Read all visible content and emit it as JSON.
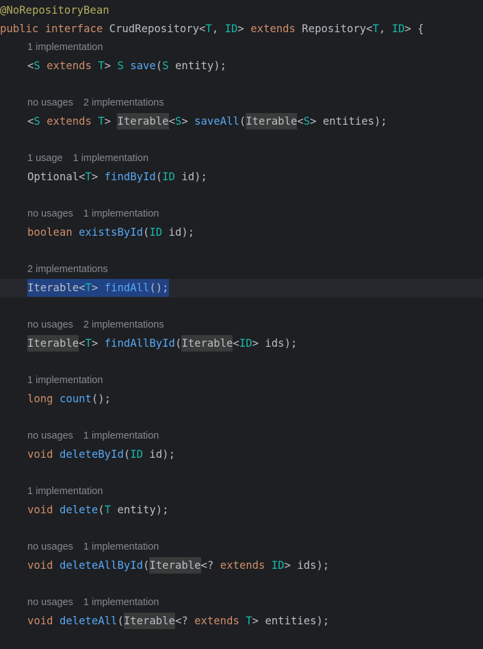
{
  "annotation": [
    [
      "@NoRepositoryBean",
      "a"
    ]
  ],
  "declaration": [
    [
      "public",
      "k"
    ],
    [
      " ",
      ""
    ],
    [
      "interface",
      "k"
    ],
    [
      " CrudRepository<",
      ""
    ],
    [
      "T",
      "t"
    ],
    [
      ", ",
      ""
    ],
    [
      "ID",
      "t"
    ],
    [
      "> ",
      ""
    ],
    [
      "extends",
      "k"
    ],
    [
      " Repository<",
      ""
    ],
    [
      "T",
      "t"
    ],
    [
      ", ",
      ""
    ],
    [
      "ID",
      "t"
    ],
    [
      "> {",
      ""
    ]
  ],
  "selected_index": 4,
  "colors": {
    "background": "#1e1f22",
    "selection": "#214283",
    "keyword": "#cf8e6d",
    "type_param": "#16baac",
    "method": "#56a8f5",
    "annotation": "#b3ae60"
  },
  "methods": [
    {
      "hints": [
        "1 implementation"
      ],
      "tokens": [
        [
          "<",
          ""
        ],
        [
          "S",
          "t"
        ],
        [
          " ",
          ""
        ],
        [
          "extends",
          "k"
        ],
        [
          " ",
          ""
        ],
        [
          "T",
          "t"
        ],
        [
          "> ",
          ""
        ],
        [
          "S",
          "t"
        ],
        [
          " ",
          ""
        ],
        [
          "save",
          "f"
        ],
        [
          "(",
          ""
        ],
        [
          "S",
          "t"
        ],
        [
          " entity);",
          ""
        ]
      ]
    },
    {
      "hints": [
        "no usages",
        "2 implementations"
      ],
      "tokens": [
        [
          "<",
          ""
        ],
        [
          "S",
          "t"
        ],
        [
          " ",
          ""
        ],
        [
          "extends",
          "k"
        ],
        [
          " ",
          ""
        ],
        [
          "T",
          "t"
        ],
        [
          "> ",
          ""
        ],
        [
          "Iterable",
          "h"
        ],
        [
          "<",
          ""
        ],
        [
          "S",
          "t"
        ],
        [
          "> ",
          ""
        ],
        [
          "saveAll",
          "f"
        ],
        [
          "(",
          ""
        ],
        [
          "Iterable",
          "h"
        ],
        [
          "<",
          ""
        ],
        [
          "S",
          "t"
        ],
        [
          "> entities);",
          ""
        ]
      ]
    },
    {
      "hints": [
        "1 usage",
        "1 implementation"
      ],
      "tokens": [
        [
          "Optional<",
          ""
        ],
        [
          "T",
          "t"
        ],
        [
          "> ",
          ""
        ],
        [
          "findById",
          "f"
        ],
        [
          "(",
          ""
        ],
        [
          "ID",
          "t"
        ],
        [
          " id);",
          ""
        ]
      ]
    },
    {
      "hints": [
        "no usages",
        "1 implementation"
      ],
      "tokens": [
        [
          "boolean",
          "k"
        ],
        [
          " ",
          ""
        ],
        [
          "existsById",
          "f"
        ],
        [
          "(",
          ""
        ],
        [
          "ID",
          "t"
        ],
        [
          " id);",
          ""
        ]
      ]
    },
    {
      "hints": [
        "2 implementations"
      ],
      "tokens": [
        [
          "Iterable<",
          ""
        ],
        [
          "T",
          "t"
        ],
        [
          "> ",
          ""
        ],
        [
          "findAll",
          "f"
        ],
        [
          "();",
          ""
        ]
      ]
    },
    {
      "hints": [
        "no usages",
        "2 implementations"
      ],
      "tokens": [
        [
          "Iterable",
          "h"
        ],
        [
          "<",
          ""
        ],
        [
          "T",
          "t"
        ],
        [
          "> ",
          ""
        ],
        [
          "findAllById",
          "f"
        ],
        [
          "(",
          ""
        ],
        [
          "Iterable",
          "h"
        ],
        [
          "<",
          ""
        ],
        [
          "ID",
          "t"
        ],
        [
          "> ids);",
          ""
        ]
      ]
    },
    {
      "hints": [
        "1 implementation"
      ],
      "tokens": [
        [
          "long",
          "k"
        ],
        [
          " ",
          ""
        ],
        [
          "count",
          "f"
        ],
        [
          "();",
          ""
        ]
      ]
    },
    {
      "hints": [
        "no usages",
        "1 implementation"
      ],
      "tokens": [
        [
          "void",
          "k"
        ],
        [
          " ",
          ""
        ],
        [
          "deleteById",
          "f"
        ],
        [
          "(",
          ""
        ],
        [
          "ID",
          "t"
        ],
        [
          " id);",
          ""
        ]
      ]
    },
    {
      "hints": [
        "1 implementation"
      ],
      "tokens": [
        [
          "void",
          "k"
        ],
        [
          " ",
          ""
        ],
        [
          "delete",
          "f"
        ],
        [
          "(",
          ""
        ],
        [
          "T",
          "t"
        ],
        [
          " entity);",
          ""
        ]
      ]
    },
    {
      "hints": [
        "no usages",
        "1 implementation"
      ],
      "tokens": [
        [
          "void",
          "k"
        ],
        [
          " ",
          ""
        ],
        [
          "deleteAllById",
          "f"
        ],
        [
          "(",
          ""
        ],
        [
          "Iterable",
          "h"
        ],
        [
          "<? ",
          ""
        ],
        [
          "extends",
          "k"
        ],
        [
          " ",
          ""
        ],
        [
          "ID",
          "t"
        ],
        [
          "> ids);",
          ""
        ]
      ]
    },
    {
      "hints": [
        "no usages",
        "1 implementation"
      ],
      "tokens": [
        [
          "void",
          "k"
        ],
        [
          " ",
          ""
        ],
        [
          "deleteAll",
          "f"
        ],
        [
          "(",
          ""
        ],
        [
          "Iterable",
          "h"
        ],
        [
          "<? ",
          ""
        ],
        [
          "extends",
          "k"
        ],
        [
          " ",
          ""
        ],
        [
          "T",
          "t"
        ],
        [
          "> entities);",
          ""
        ]
      ]
    }
  ]
}
